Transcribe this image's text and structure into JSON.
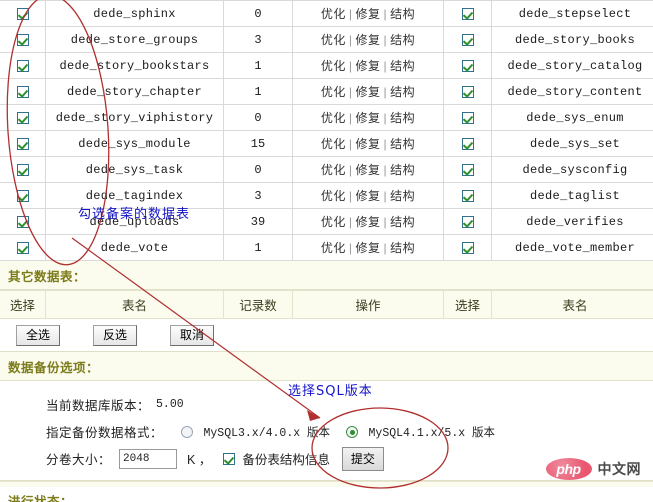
{
  "table": {
    "columns": [
      "选择",
      "表名",
      "记录数",
      "操作",
      "选择",
      "表名"
    ],
    "ops_labels": {
      "optimize": "优化",
      "repair": "修复",
      "structure": "结构",
      "separator": "|"
    },
    "rows": [
      {
        "checked": true,
        "name": "dede_sphinx",
        "count": "0",
        "checked2": true,
        "name2": "dede_stepselect"
      },
      {
        "checked": true,
        "name": "dede_store_groups",
        "count": "3",
        "checked2": true,
        "name2": "dede_story_books"
      },
      {
        "checked": true,
        "name": "dede_story_bookstars",
        "count": "1",
        "checked2": true,
        "name2": "dede_story_catalog"
      },
      {
        "checked": true,
        "name": "dede_story_chapter",
        "count": "1",
        "checked2": true,
        "name2": "dede_story_content"
      },
      {
        "checked": true,
        "name": "dede_story_viphistory",
        "count": "0",
        "checked2": true,
        "name2": "dede_sys_enum"
      },
      {
        "checked": true,
        "name": "dede_sys_module",
        "count": "15",
        "checked2": true,
        "name2": "dede_sys_set"
      },
      {
        "checked": true,
        "name": "dede_sys_task",
        "count": "0",
        "checked2": true,
        "name2": "dede_sysconfig"
      },
      {
        "checked": true,
        "name": "dede_tagindex",
        "count": "3",
        "checked2": true,
        "name2": "dede_taglist"
      },
      {
        "checked": true,
        "name": "dede_uploads",
        "count": "39",
        "checked2": true,
        "name2": "dede_verifies"
      },
      {
        "checked": true,
        "name": "dede_vote",
        "count": "1",
        "checked2": true,
        "name2": "dede_vote_member"
      }
    ]
  },
  "other_tables": {
    "heading": "其它数据表：",
    "columns": [
      "选择",
      "表名",
      "记录数",
      "操作",
      "选择",
      "表名"
    ],
    "buttons": {
      "select_all": "全选",
      "invert": "反选",
      "cancel": "取消"
    }
  },
  "backup_options": {
    "heading": "数据备份选项：",
    "db_version_label": "当前数据库版本：",
    "db_version_value": "5.00",
    "format_label": "指定备份数据格式：",
    "format_options": [
      {
        "label": "MySQL3.x/4.0.x 版本",
        "selected": false
      },
      {
        "label": "MySQL4.1.x/5.x 版本",
        "selected": true
      }
    ],
    "volume_label": "分卷大小：",
    "volume_value": "2048",
    "volume_unit": "K ，",
    "struct_checkbox_label": "备份表结构信息",
    "struct_checked": true,
    "submit_label": "提交"
  },
  "status": {
    "heading": "进行状态："
  },
  "annotations": [
    {
      "text": "勾选备案的数据表",
      "color": "#1414c8"
    },
    {
      "text": "选择SQL版本",
      "color": "#1414c8"
    }
  ],
  "watermark": {
    "badge": "php",
    "text": "中文网"
  },
  "colors": {
    "annotation_blue": "#1414c8",
    "annotation_red": "#b03030",
    "heading_olive": "#7c7c1b",
    "panel_cream": "#fbfbee",
    "check_green": "#2f8f2f"
  }
}
